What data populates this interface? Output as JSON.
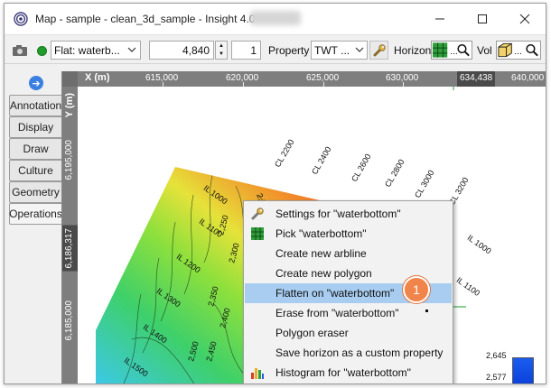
{
  "window": {
    "title": "Map - sample - clean_3d_sample - Insight 4.0"
  },
  "toolbar": {
    "horizon_select": "Flat: waterb...",
    "value": "4,840",
    "step": "1",
    "property_label": "Property",
    "property_select": "TWT ...",
    "horizon_label": "Horizon",
    "horizon_tool_text": "...",
    "vol_label": "Vol",
    "vol_tool_text": "..."
  },
  "side_tabs": [
    "Annotation",
    "Display",
    "Draw",
    "Culture",
    "Geometry",
    "Operations"
  ],
  "map": {
    "x_axis_label": "X (m)",
    "y_axis_label": "Y (m)",
    "x_ticks": [
      "615,000",
      "620,000",
      "625,000",
      "630,000",
      "640,000"
    ],
    "x_cursor": "634,438",
    "y_ticks": [
      "6,195,000",
      "6,185,000"
    ],
    "y_cursor": "6,186,317",
    "inline_labels": [
      "IL 1000",
      "IL 1100",
      "IL 1200",
      "IL 1300",
      "IL 1400",
      "IL 1500",
      "IL 1000",
      "IL 1100"
    ],
    "crossline_labels": [
      "CL 2200",
      "CL 2400",
      "CL 2600",
      "CL 2800",
      "CL 3000",
      "CL 3200"
    ],
    "contour_labels": [
      "2,150",
      "2,250",
      "2,300",
      "2,350",
      "2,400",
      "2,450",
      "2,500"
    ]
  },
  "context_menu": {
    "items": [
      {
        "label": "Settings for \"waterbottom\"",
        "icon": "wrench-icon"
      },
      {
        "label": "Pick \"waterbottom\"",
        "icon": "grid-pick-icon"
      },
      {
        "label": "Create new arbline",
        "icon": ""
      },
      {
        "label": "Create new polygon",
        "icon": ""
      },
      {
        "label": "Flatten on \"waterbottom\"",
        "icon": "",
        "highlighted": true
      },
      {
        "label": "Erase from \"waterbottom\"",
        "icon": ""
      },
      {
        "label": "Polygon eraser",
        "icon": ""
      },
      {
        "label": "Save horizon as a custom property",
        "icon": ""
      },
      {
        "label": "Histogram for \"waterbottom\"",
        "icon": "histogram-icon"
      }
    ]
  },
  "callout": {
    "number": "1",
    "color": "#f0844a"
  },
  "legend": {
    "max": "2,645",
    "min": "2,577"
  },
  "colors": {
    "highlight": "#a8cdf1",
    "ruler": "#7e7e7e",
    "status_green": "#1f9c2c"
  }
}
